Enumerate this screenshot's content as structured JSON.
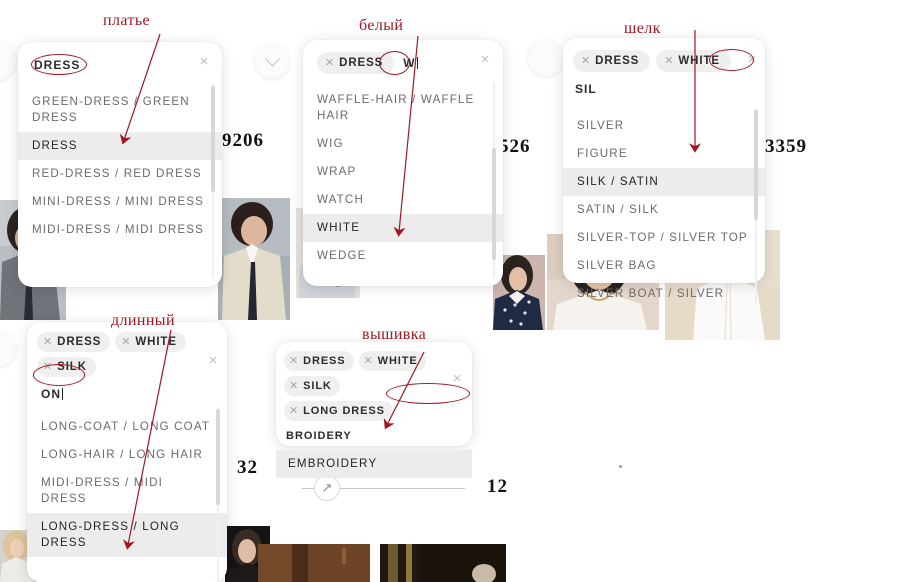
{
  "meta": {
    "accent_red": "#a01722",
    "chip_bg": "#efefef",
    "selected_bg": "#ececec"
  },
  "background": {
    "numbers": [
      {
        "value": "9206"
      },
      {
        "value": "526"
      },
      {
        "value": "3359"
      },
      {
        "value": "32"
      },
      {
        "value": "12"
      }
    ],
    "slider": {
      "icon": "resize-arrow-icon"
    }
  },
  "annotations": [
    {
      "id": "a1",
      "text": "платье",
      "meaning": "dress"
    },
    {
      "id": "a2",
      "text": "белый",
      "meaning": "white"
    },
    {
      "id": "a3",
      "text": "шелк",
      "meaning": "silk"
    },
    {
      "id": "a4",
      "text": "длинный",
      "meaning": "long"
    },
    {
      "id": "a5",
      "text": "вышивка",
      "meaning": "embroidery"
    }
  ],
  "panels": {
    "p1": {
      "name": "dress-autocomplete-panel",
      "query": "DRESS",
      "chips": [],
      "close_label": "×",
      "options": [
        {
          "label": "GREEN-DRESS / GREEN DRESS",
          "selected": false
        },
        {
          "label": "DRESS",
          "selected": true
        },
        {
          "label": "RED-DRESS / RED DRESS",
          "selected": false
        },
        {
          "label": "MINI-DRESS / MINI DRESS",
          "selected": false
        },
        {
          "label": "MIDI-DRESS / MIDI DRESS",
          "selected": false
        }
      ]
    },
    "p2": {
      "name": "white-autocomplete-panel",
      "query": "W",
      "chips": [
        {
          "label": "DRESS"
        }
      ],
      "close_label": "×",
      "options": [
        {
          "label": "WAFFLE-HAIR / WAFFLE HAIR",
          "selected": false
        },
        {
          "label": "WIG",
          "selected": false
        },
        {
          "label": "WRAP",
          "selected": false
        },
        {
          "label": "WATCH",
          "selected": false
        },
        {
          "label": "WHITE",
          "selected": true
        },
        {
          "label": "WEDGE",
          "selected": false
        }
      ]
    },
    "p3": {
      "name": "silk-autocomplete-panel",
      "query": "SIL",
      "chips": [
        {
          "label": "DRESS"
        },
        {
          "label": "WHITE"
        }
      ],
      "close_label": "×",
      "options": [
        {
          "label": "SILVER",
          "selected": false
        },
        {
          "label": "FIGURE",
          "selected": false
        },
        {
          "label": "SILK / SATIN",
          "selected": true
        },
        {
          "label": "SATIN / SILK",
          "selected": false
        },
        {
          "label": "SILVER-TOP / SILVER TOP",
          "selected": false
        },
        {
          "label": "SILVER BAG",
          "selected": false
        },
        {
          "label": "SILVER BOAT / SILVER",
          "selected": false
        }
      ]
    },
    "p4": {
      "name": "long-autocomplete-panel",
      "query": "ON",
      "chips": [
        {
          "label": "DRESS"
        },
        {
          "label": "WHITE"
        },
        {
          "label": "SILK"
        }
      ],
      "close_label": "×",
      "options": [
        {
          "label": "LONG-COAT / LONG COAT",
          "selected": false
        },
        {
          "label": "LONG-HAIR / LONG HAIR",
          "selected": false
        },
        {
          "label": "MIDI-DRESS / MIDI DRESS",
          "selected": false
        },
        {
          "label": "LONG-DRESS / LONG DRESS",
          "selected": true
        }
      ]
    },
    "p5": {
      "name": "embroidery-autocomplete-panel",
      "query": "BROIDERY",
      "chips": [
        {
          "label": "DRESS"
        },
        {
          "label": "WHITE"
        },
        {
          "label": "SILK"
        },
        {
          "label": "LONG DRESS"
        }
      ],
      "close_label": "×",
      "options": [
        {
          "label": "EMBROIDERY",
          "selected": true
        }
      ]
    }
  }
}
